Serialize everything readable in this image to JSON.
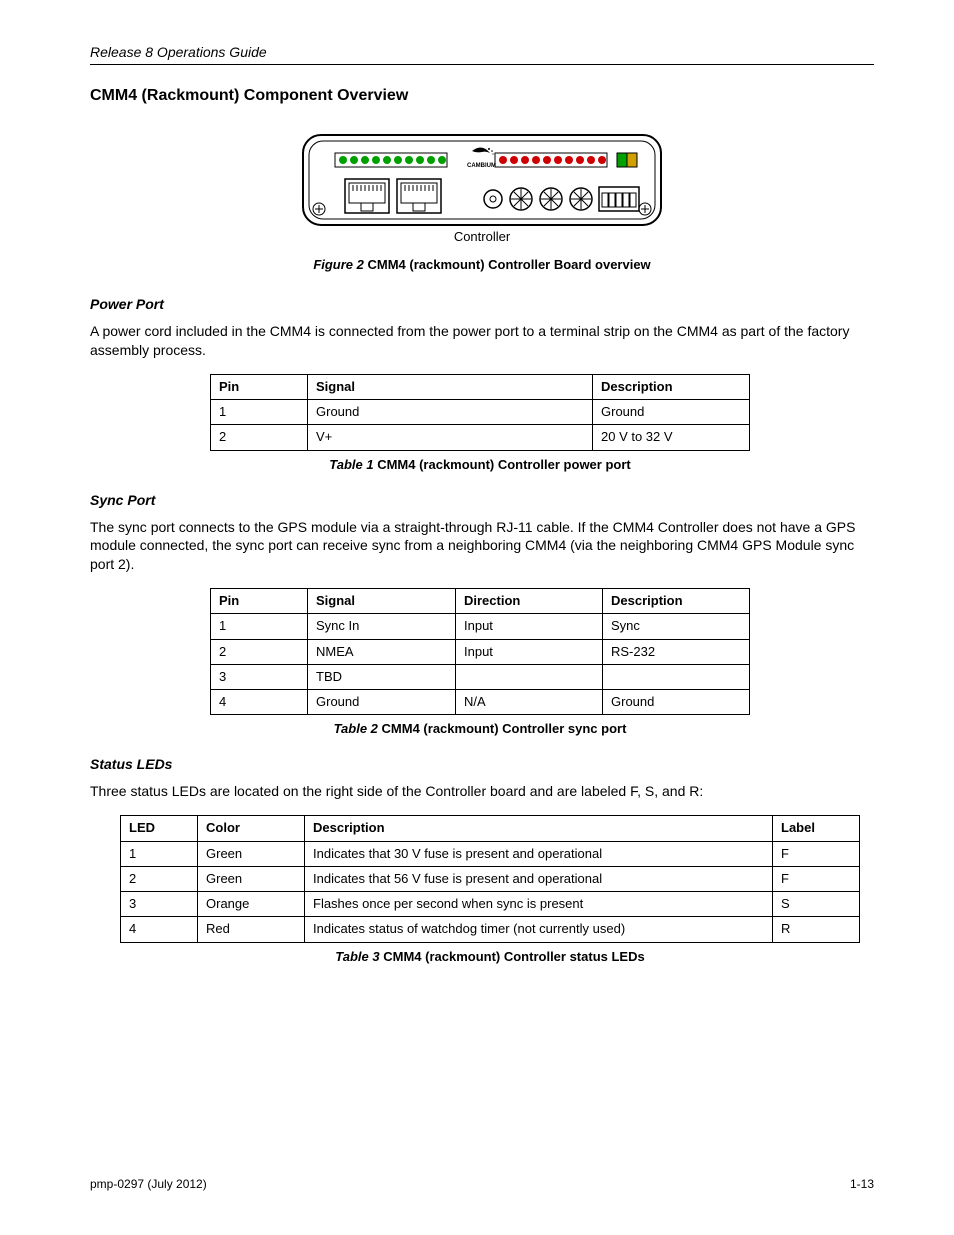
{
  "header": {
    "running_title": "Release 8 Operations Guide"
  },
  "section": {
    "title": "CMM4 (Rackmount) Component Overview"
  },
  "figure": {
    "number": "Figure 2",
    "caption_suffix": "CMM4 (rackmount) Controller Board overview",
    "controller_label": "Controller",
    "logo_text": "CAMBIUM"
  },
  "sub_power": {
    "heading": "Power Port",
    "text": "A power cord included in the CMM4 is connected from the power port to a terminal strip on the CMM4 as part of the factory assembly process.",
    "table_caption_num": "Table 1",
    "table_caption_suffix": "CMM4 (rackmount) Controller power port",
    "headers": [
      "Pin",
      "Signal",
      "Description"
    ],
    "rows": [
      [
        "1",
        "Ground",
        "Ground"
      ],
      [
        "2",
        "V+",
        "20 V to 32 V"
      ]
    ]
  },
  "sub_sync": {
    "heading": "Sync Port",
    "text": "The sync port connects to the GPS module via a straight-through RJ-11 cable. If the CMM4 Controller does not have a GPS module connected, the sync port can receive sync from a neighboring CMM4 (via the neighboring CMM4 GPS Module sync port 2).",
    "table_caption_num": "Table 2",
    "table_caption_suffix": "CMM4 (rackmount) Controller sync port",
    "headers": [
      "Pin",
      "Signal",
      "Direction",
      "Description"
    ],
    "rows": [
      [
        "1",
        "Sync In",
        "Input",
        "Sync"
      ],
      [
        "2",
        "NMEA",
        "Input",
        "RS-232"
      ],
      [
        "3",
        "TBD",
        "",
        ""
      ],
      [
        "4",
        "Ground",
        "N/A",
        "Ground"
      ]
    ]
  },
  "sub_status": {
    "heading": "Status LEDs",
    "text": "Three status LEDs are located on the right side of the Controller board and are labeled F, S, and R:",
    "table_caption_num": "Table 3",
    "table_caption_suffix": "CMM4 (rackmount) Controller status LEDs",
    "headers": [
      "LED",
      "Color",
      "Description",
      "Label"
    ],
    "rows": [
      [
        "1",
        "Green",
        "Indicates that 30 V fuse is present and operational",
        "F"
      ],
      [
        "2",
        "Green",
        "Indicates that 56 V fuse is present and operational",
        "F"
      ],
      [
        "3",
        "Orange",
        "Flashes once per second when sync is present",
        "S"
      ],
      [
        "4",
        "Red",
        "Indicates status of watchdog timer (not currently used)",
        "R"
      ]
    ]
  },
  "footer": {
    "left": "pmp-0297 (July 2012)",
    "right": "1-13"
  }
}
